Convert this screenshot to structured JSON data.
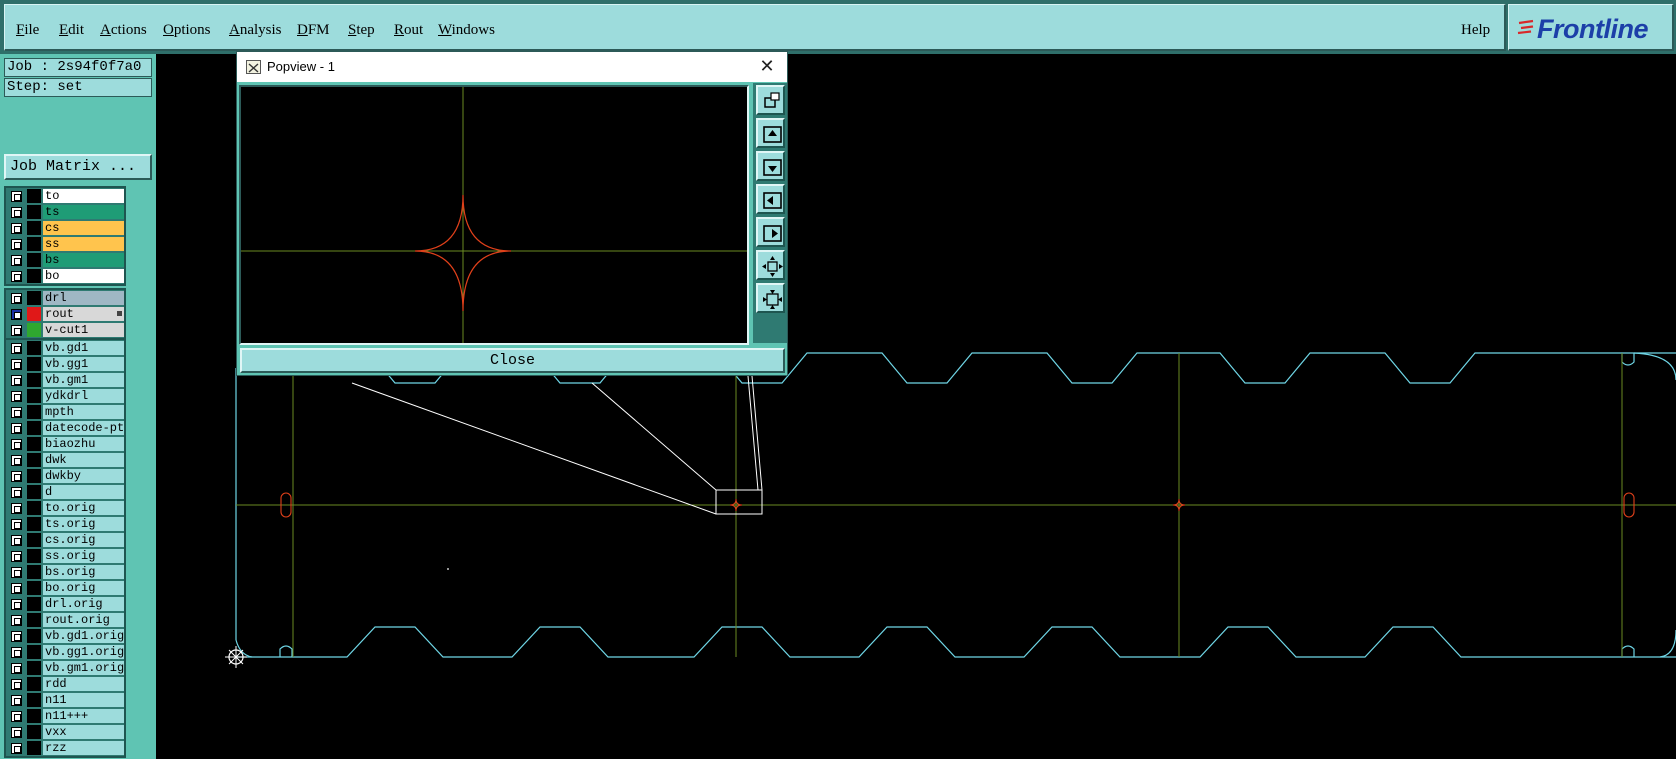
{
  "menubar": {
    "items": [
      {
        "pre": "",
        "mn": "F",
        "post": "ile"
      },
      {
        "pre": "",
        "mn": "E",
        "post": "dit"
      },
      {
        "pre": "",
        "mn": "A",
        "post": "ctions"
      },
      {
        "pre": "",
        "mn": "O",
        "post": "ptions"
      },
      {
        "pre": "",
        "mn": "A",
        "post": "nalysis"
      },
      {
        "pre": "",
        "mn": "D",
        "post": "FM"
      },
      {
        "pre": "",
        "mn": "S",
        "post": "tep"
      },
      {
        "pre": "",
        "mn": "R",
        "post": "out"
      },
      {
        "pre": "",
        "mn": "W",
        "post": "indows"
      }
    ],
    "help_label": "Help",
    "logo_text": "Frontline"
  },
  "left_panel": {
    "job_label": "Job : 2s94f0f7a0",
    "step_label": "Step: set",
    "job_matrix_label": "Job Matrix ..."
  },
  "layers": {
    "board": [
      {
        "name": "to",
        "swatch": "#000000",
        "bg": "#ffffff",
        "checked": false
      },
      {
        "name": "ts",
        "swatch": "#000000",
        "bg": "#1f9c76",
        "checked": false
      },
      {
        "name": "cs",
        "swatch": "#000000",
        "bg": "#ffc44d",
        "checked": false
      },
      {
        "name": "ss",
        "swatch": "#000000",
        "bg": "#ffc44d",
        "checked": false
      },
      {
        "name": "bs",
        "swatch": "#000000",
        "bg": "#1f9c76",
        "checked": false
      },
      {
        "name": "bo",
        "swatch": "#000000",
        "bg": "#ffffff",
        "checked": false
      }
    ],
    "drill": [
      {
        "name": "drl",
        "swatch": "#000000",
        "bg": "#9fb7c4",
        "checked": false
      },
      {
        "name": "rout",
        "swatch": "#e01818",
        "bg": "#d8d8d8",
        "checked": true,
        "flag": true
      },
      {
        "name": "v-cut1",
        "swatch": "#2fa82f",
        "bg": "#d8d8d8",
        "checked": false
      }
    ],
    "misc": [
      {
        "name": "vb.gd1",
        "swatch": "#000000",
        "bg": "#9ddcdc",
        "checked": false
      },
      {
        "name": "vb.gg1",
        "swatch": "#000000",
        "bg": "#9ddcdc",
        "checked": false
      },
      {
        "name": "vb.gm1",
        "swatch": "#000000",
        "bg": "#9ddcdc",
        "checked": false
      },
      {
        "name": "ydkdrl",
        "swatch": "#000000",
        "bg": "#9ddcdc",
        "checked": false
      },
      {
        "name": "mpth",
        "swatch": "#000000",
        "bg": "#9ddcdc",
        "checked": false
      },
      {
        "name": "datecode-pte",
        "swatch": "#000000",
        "bg": "#9ddcdc",
        "checked": false
      },
      {
        "name": "biaozhu",
        "swatch": "#000000",
        "bg": "#9ddcdc",
        "checked": false
      },
      {
        "name": "dwk",
        "swatch": "#000000",
        "bg": "#9ddcdc",
        "checked": false
      },
      {
        "name": "dwkby",
        "swatch": "#000000",
        "bg": "#9ddcdc",
        "checked": false
      },
      {
        "name": "d",
        "swatch": "#000000",
        "bg": "#9ddcdc",
        "checked": false
      },
      {
        "name": "to.orig",
        "swatch": "#000000",
        "bg": "#9ddcdc",
        "checked": false
      },
      {
        "name": "ts.orig",
        "swatch": "#000000",
        "bg": "#9ddcdc",
        "checked": false
      },
      {
        "name": "cs.orig",
        "swatch": "#000000",
        "bg": "#9ddcdc",
        "checked": false
      },
      {
        "name": "ss.orig",
        "swatch": "#000000",
        "bg": "#9ddcdc",
        "checked": false
      },
      {
        "name": "bs.orig",
        "swatch": "#000000",
        "bg": "#9ddcdc",
        "checked": false
      },
      {
        "name": "bo.orig",
        "swatch": "#000000",
        "bg": "#9ddcdc",
        "checked": false
      },
      {
        "name": "drl.orig",
        "swatch": "#000000",
        "bg": "#9ddcdc",
        "checked": false
      },
      {
        "name": "rout.orig",
        "swatch": "#000000",
        "bg": "#9ddcdc",
        "checked": false
      },
      {
        "name": "vb.gd1.orig",
        "swatch": "#000000",
        "bg": "#9ddcdc",
        "checked": false
      },
      {
        "name": "vb.gg1.orig",
        "swatch": "#000000",
        "bg": "#9ddcdc",
        "checked": false
      },
      {
        "name": "vb.gm1.orig",
        "swatch": "#000000",
        "bg": "#9ddcdc",
        "checked": false
      },
      {
        "name": "rdd",
        "swatch": "#000000",
        "bg": "#9ddcdc",
        "checked": false
      },
      {
        "name": "n11",
        "swatch": "#000000",
        "bg": "#9ddcdc",
        "checked": false
      },
      {
        "name": "n11+++",
        "swatch": "#000000",
        "bg": "#9ddcdc",
        "checked": false
      },
      {
        "name": "vxx",
        "swatch": "#000000",
        "bg": "#9ddcdc",
        "checked": false
      },
      {
        "name": "rzz",
        "swatch": "#000000",
        "bg": "#9ddcdc",
        "checked": false
      }
    ]
  },
  "popview": {
    "title": "Popview - 1",
    "close_label": "Close",
    "tools": [
      "zoom-home-icon",
      "pan-up-icon",
      "pan-down-icon",
      "pan-left-icon",
      "pan-right-icon",
      "zoom-in-icon",
      "zoom-out-icon"
    ]
  },
  "colors": {
    "outline": "#6fd6e6",
    "rout": "#e0401a",
    "axis": "#6a8a22",
    "zoom_box": "#ffffff"
  }
}
